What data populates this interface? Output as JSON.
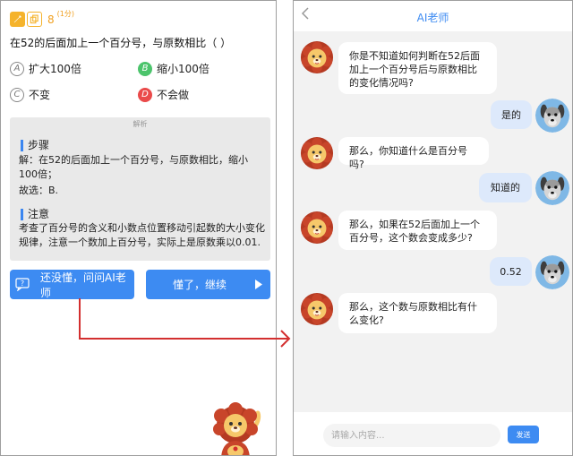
{
  "left": {
    "question_number": "8",
    "question_score": "(1分)",
    "question_text": "在52的后面加上一个百分号，与原数相比（    ）",
    "options": [
      {
        "letter": "A",
        "text": "扩大100倍"
      },
      {
        "letter": "B",
        "text": "缩小100倍"
      },
      {
        "letter": "C",
        "text": "不变"
      },
      {
        "letter": "D",
        "text": "不会做"
      }
    ],
    "explain_title": "解析",
    "steps_title": "步骤",
    "steps_line1": "解：在52的后面加上一个百分号，与原数相比，缩小100倍；",
    "steps_line2": "故选：B.",
    "note_title": "注意",
    "note_text": "考查了百分号的含义和小数点位置移动引起数的大小变化规律，注意一个数加上百分号，实际上是原数乘以0.01.",
    "ask_button": "还没懂，问问AI老师",
    "continue_button": "懂了，继续"
  },
  "right": {
    "title": "AI老师",
    "messages": [
      {
        "from": "ai",
        "text": "你是不知道如何判断在52后面加上一个百分号后与原数相比的变化情况吗?"
      },
      {
        "from": "user",
        "text": "是的"
      },
      {
        "from": "ai",
        "text": "那么，你知道什么是百分号吗?"
      },
      {
        "from": "user",
        "text": "知道的"
      },
      {
        "from": "ai",
        "text": "那么，如果在52后面加上一个百分号，这个数会变成多少?"
      },
      {
        "from": "user",
        "text": "0.52"
      },
      {
        "from": "ai",
        "text": "那么，这个数与原数相比有什么变化?"
      }
    ],
    "input_placeholder": "请输入内容...",
    "send_button": "发送"
  },
  "colors": {
    "accent": "#3d8bf2",
    "correct": "#4cc46c",
    "wrong": "#ea4a4a",
    "arrow": "#d32f2f",
    "badge": "#f5b32b"
  },
  "icons": [
    "pencil-icon",
    "copy-icon",
    "chat-question-icon",
    "play-arrow-icon",
    "back-chevron-icon",
    "lion-avatar",
    "dog-avatar",
    "lion-mascot"
  ]
}
